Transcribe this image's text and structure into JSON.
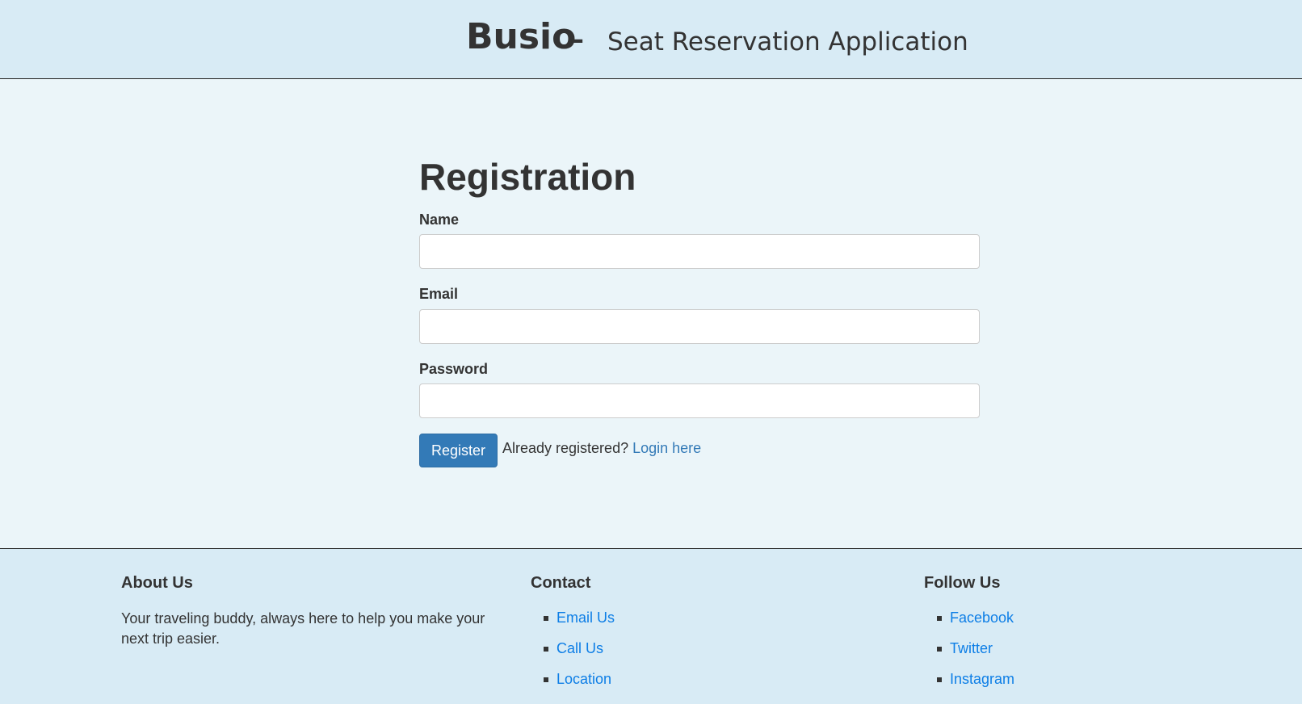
{
  "header": {
    "brand": "Busio",
    "separator": "–",
    "tagline": "Seat Reservation Application"
  },
  "form": {
    "title": "Registration",
    "name_label": "Name",
    "name_value": "",
    "email_label": "Email",
    "email_value": "",
    "password_label": "Password",
    "password_value": "",
    "register_label": "Register",
    "already_text": "Already registered?",
    "login_link": "Login here"
  },
  "footer": {
    "about": {
      "heading": "About Us",
      "text": "Your traveling buddy, always here to help you make your next trip easier."
    },
    "contact": {
      "heading": "Contact",
      "links": [
        "Email Us",
        "Call Us",
        "Location"
      ]
    },
    "follow": {
      "heading": "Follow Us",
      "links": [
        "Facebook",
        "Twitter",
        "Instagram"
      ]
    }
  },
  "colors": {
    "header_bg": "#d8ebf5",
    "main_bg": "#ebf5f9",
    "primary_button": "#337ab7",
    "link": "#0d7ee6"
  }
}
